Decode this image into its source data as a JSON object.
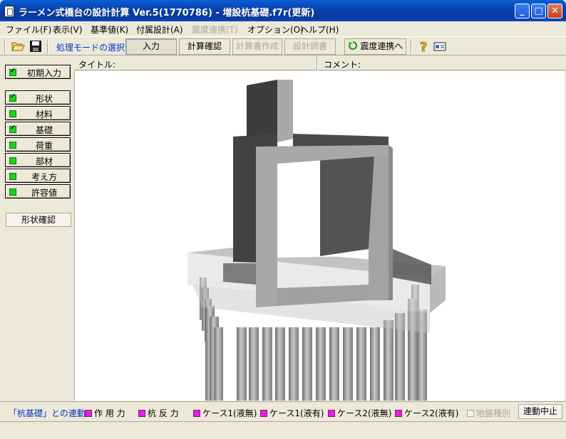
{
  "window": {
    "title": "ラーメン式橋台の設計計算 Ver.5(1770786) - 増設杭基礎.f7r(更新)"
  },
  "menu": {
    "items": [
      {
        "label": "ファイル(F)",
        "enabled": true
      },
      {
        "label": "表示(V)",
        "enabled": true
      },
      {
        "label": "基準値(K)",
        "enabled": true
      },
      {
        "label": "付属設計(A)",
        "enabled": true
      },
      {
        "label": "震度連携(T)",
        "enabled": false
      },
      {
        "label": "オプション(O)",
        "enabled": true
      },
      {
        "label": "ヘルプ(H)",
        "enabled": true
      }
    ]
  },
  "toolbar": {
    "mode_label": "処理モードの選択",
    "input_label": "入力",
    "calc_check_label": "計算確認",
    "report_create_label": "計算書作成",
    "design_report_label": "設計調書",
    "seismic_link_label": "震度連携へ",
    "icons": [
      "folder-open-icon",
      "save-icon",
      "help-icon",
      "about-icon"
    ]
  },
  "nav": {
    "initial_input": "初期入力",
    "items": [
      {
        "label": "形状",
        "checked": true
      },
      {
        "label": "材料",
        "checked": false
      },
      {
        "label": "基礎",
        "checked": true
      },
      {
        "label": "荷重",
        "checked": false
      },
      {
        "label": "部材",
        "checked": false
      },
      {
        "label": "考え方",
        "checked": false
      },
      {
        "label": "許容値",
        "checked": false
      }
    ],
    "shape_check": "形状確認"
  },
  "info": {
    "title_label": "タイトル:",
    "comment_label": "コメント:"
  },
  "linkbar": {
    "title": "「杭基礎」との連動",
    "items": [
      {
        "label": "作 用 力",
        "enabled": true
      },
      {
        "label": "杭 反 力",
        "enabled": true
      },
      {
        "label": "ケース1(液無)",
        "enabled": true
      },
      {
        "label": "ケース1(液有)",
        "enabled": true
      },
      {
        "label": "ケース2(液無)",
        "enabled": true
      },
      {
        "label": "ケース2(液有)",
        "enabled": true
      },
      {
        "label": "地盤種別",
        "enabled": false
      }
    ],
    "stop_label": "連動中止"
  },
  "colors": {
    "titlebar": "#0842b0",
    "green_indicator": "#1ad41a",
    "magenta_indicator": "#e81ee8",
    "link_blue": "#0033cc"
  }
}
